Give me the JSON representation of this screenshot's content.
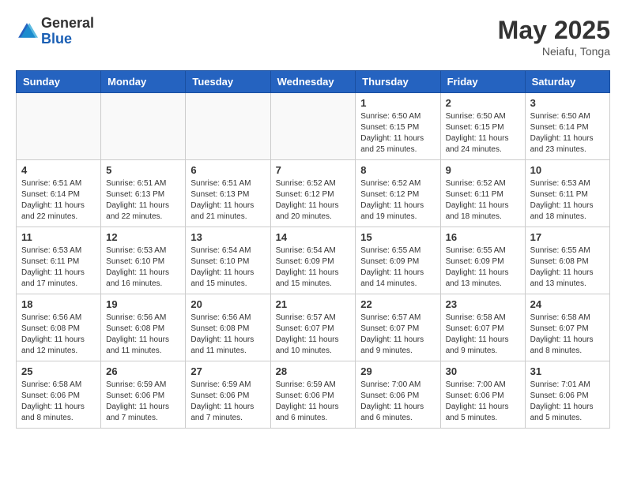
{
  "header": {
    "logo_general": "General",
    "logo_blue": "Blue",
    "title": "May 2025",
    "location": "Neiafu, Tonga"
  },
  "weekdays": [
    "Sunday",
    "Monday",
    "Tuesday",
    "Wednesday",
    "Thursday",
    "Friday",
    "Saturday"
  ],
  "weeks": [
    [
      {
        "day": "",
        "info": ""
      },
      {
        "day": "",
        "info": ""
      },
      {
        "day": "",
        "info": ""
      },
      {
        "day": "",
        "info": ""
      },
      {
        "day": "1",
        "info": "Sunrise: 6:50 AM\nSunset: 6:15 PM\nDaylight: 11 hours and 25 minutes."
      },
      {
        "day": "2",
        "info": "Sunrise: 6:50 AM\nSunset: 6:15 PM\nDaylight: 11 hours and 24 minutes."
      },
      {
        "day": "3",
        "info": "Sunrise: 6:50 AM\nSunset: 6:14 PM\nDaylight: 11 hours and 23 minutes."
      }
    ],
    [
      {
        "day": "4",
        "info": "Sunrise: 6:51 AM\nSunset: 6:14 PM\nDaylight: 11 hours and 22 minutes."
      },
      {
        "day": "5",
        "info": "Sunrise: 6:51 AM\nSunset: 6:13 PM\nDaylight: 11 hours and 22 minutes."
      },
      {
        "day": "6",
        "info": "Sunrise: 6:51 AM\nSunset: 6:13 PM\nDaylight: 11 hours and 21 minutes."
      },
      {
        "day": "7",
        "info": "Sunrise: 6:52 AM\nSunset: 6:12 PM\nDaylight: 11 hours and 20 minutes."
      },
      {
        "day": "8",
        "info": "Sunrise: 6:52 AM\nSunset: 6:12 PM\nDaylight: 11 hours and 19 minutes."
      },
      {
        "day": "9",
        "info": "Sunrise: 6:52 AM\nSunset: 6:11 PM\nDaylight: 11 hours and 18 minutes."
      },
      {
        "day": "10",
        "info": "Sunrise: 6:53 AM\nSunset: 6:11 PM\nDaylight: 11 hours and 18 minutes."
      }
    ],
    [
      {
        "day": "11",
        "info": "Sunrise: 6:53 AM\nSunset: 6:11 PM\nDaylight: 11 hours and 17 minutes."
      },
      {
        "day": "12",
        "info": "Sunrise: 6:53 AM\nSunset: 6:10 PM\nDaylight: 11 hours and 16 minutes."
      },
      {
        "day": "13",
        "info": "Sunrise: 6:54 AM\nSunset: 6:10 PM\nDaylight: 11 hours and 15 minutes."
      },
      {
        "day": "14",
        "info": "Sunrise: 6:54 AM\nSunset: 6:09 PM\nDaylight: 11 hours and 15 minutes."
      },
      {
        "day": "15",
        "info": "Sunrise: 6:55 AM\nSunset: 6:09 PM\nDaylight: 11 hours and 14 minutes."
      },
      {
        "day": "16",
        "info": "Sunrise: 6:55 AM\nSunset: 6:09 PM\nDaylight: 11 hours and 13 minutes."
      },
      {
        "day": "17",
        "info": "Sunrise: 6:55 AM\nSunset: 6:08 PM\nDaylight: 11 hours and 13 minutes."
      }
    ],
    [
      {
        "day": "18",
        "info": "Sunrise: 6:56 AM\nSunset: 6:08 PM\nDaylight: 11 hours and 12 minutes."
      },
      {
        "day": "19",
        "info": "Sunrise: 6:56 AM\nSunset: 6:08 PM\nDaylight: 11 hours and 11 minutes."
      },
      {
        "day": "20",
        "info": "Sunrise: 6:56 AM\nSunset: 6:08 PM\nDaylight: 11 hours and 11 minutes."
      },
      {
        "day": "21",
        "info": "Sunrise: 6:57 AM\nSunset: 6:07 PM\nDaylight: 11 hours and 10 minutes."
      },
      {
        "day": "22",
        "info": "Sunrise: 6:57 AM\nSunset: 6:07 PM\nDaylight: 11 hours and 9 minutes."
      },
      {
        "day": "23",
        "info": "Sunrise: 6:58 AM\nSunset: 6:07 PM\nDaylight: 11 hours and 9 minutes."
      },
      {
        "day": "24",
        "info": "Sunrise: 6:58 AM\nSunset: 6:07 PM\nDaylight: 11 hours and 8 minutes."
      }
    ],
    [
      {
        "day": "25",
        "info": "Sunrise: 6:58 AM\nSunset: 6:06 PM\nDaylight: 11 hours and 8 minutes."
      },
      {
        "day": "26",
        "info": "Sunrise: 6:59 AM\nSunset: 6:06 PM\nDaylight: 11 hours and 7 minutes."
      },
      {
        "day": "27",
        "info": "Sunrise: 6:59 AM\nSunset: 6:06 PM\nDaylight: 11 hours and 7 minutes."
      },
      {
        "day": "28",
        "info": "Sunrise: 6:59 AM\nSunset: 6:06 PM\nDaylight: 11 hours and 6 minutes."
      },
      {
        "day": "29",
        "info": "Sunrise: 7:00 AM\nSunset: 6:06 PM\nDaylight: 11 hours and 6 minutes."
      },
      {
        "day": "30",
        "info": "Sunrise: 7:00 AM\nSunset: 6:06 PM\nDaylight: 11 hours and 5 minutes."
      },
      {
        "day": "31",
        "info": "Sunrise: 7:01 AM\nSunset: 6:06 PM\nDaylight: 11 hours and 5 minutes."
      }
    ]
  ]
}
